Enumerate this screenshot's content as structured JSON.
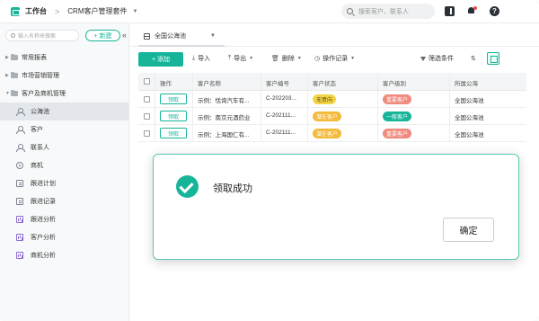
{
  "topbar": {
    "app_name": "工作台",
    "separator": ">",
    "suite_name": "CRM客户管理套件",
    "search_placeholder": "搜索客户、联系人",
    "help_glyph": "?"
  },
  "sidebar": {
    "search_placeholder": "输入名称来搜索",
    "new_button": "+ 新建",
    "collapse_glyph": "«",
    "groups": [
      {
        "label": "常用报表"
      },
      {
        "label": "市场营销管理"
      },
      {
        "label": "客户及商机管理"
      }
    ],
    "items": [
      {
        "label": "公海池",
        "icon": "person-icon",
        "active": true
      },
      {
        "label": "客户",
        "icon": "person-icon"
      },
      {
        "label": "联系人",
        "icon": "person-icon"
      },
      {
        "label": "商机",
        "icon": "target-icon"
      },
      {
        "label": "跟进计划",
        "icon": "doc-icon"
      },
      {
        "label": "跟进记录",
        "icon": "doc-icon"
      },
      {
        "label": "跟进分析",
        "icon": "chart-icon"
      },
      {
        "label": "客户分析",
        "icon": "chart-icon"
      },
      {
        "label": "商机分析",
        "icon": "chart-icon"
      }
    ]
  },
  "view": {
    "label": "全国公海池"
  },
  "toolbar": {
    "add": "+ 添加",
    "import": "导入",
    "export": "导出",
    "delete": "删除",
    "history": "操作记录",
    "filter": "筛选条件"
  },
  "table": {
    "headers": [
      "操作",
      "客户名称",
      "客户编号",
      "客户状态",
      "客户级别",
      "所属公海"
    ],
    "claim_label": "领取",
    "rows": [
      {
        "name": "示例：恬询汽车有...",
        "code": "C-202203...",
        "status": "无意向",
        "status_color": "#f5d547",
        "level": "重要客户",
        "level_color": "#f08a7e",
        "pool": "全国公海池"
      },
      {
        "name": "示例：南京元酒药业",
        "code": "C-202111...",
        "status": "潜在客户",
        "status_color": "#f5b93b",
        "level": "一般客户",
        "level_color": "#16b59a",
        "pool": "全国公海池"
      },
      {
        "name": "示例：上海国仁有...",
        "code": "C-202111...",
        "status": "潜在客户",
        "status_color": "#f5b93b",
        "level": "重要客户",
        "level_color": "#f08a7e",
        "pool": "全国公海池"
      }
    ]
  },
  "dialog": {
    "title": "领取成功",
    "confirm": "确定"
  },
  "colors": {
    "accent": "#16b59a"
  }
}
